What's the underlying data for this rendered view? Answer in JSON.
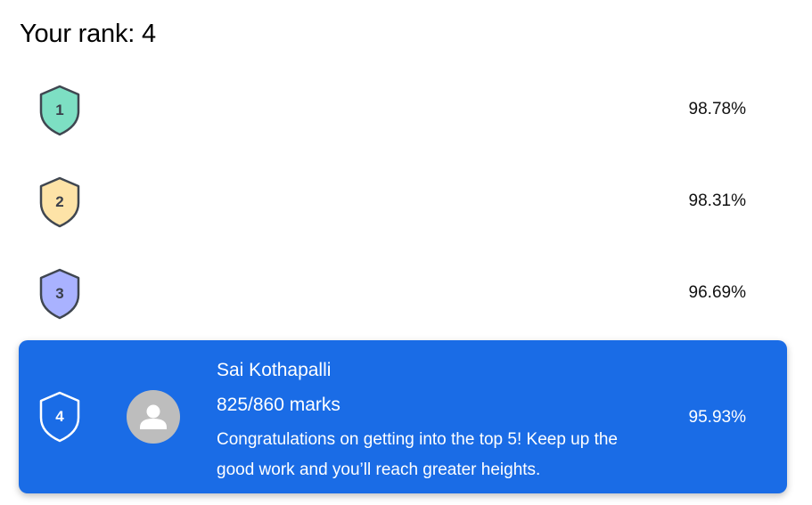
{
  "header": {
    "title": "Your rank: 4"
  },
  "leaderboard": {
    "rows": [
      {
        "rank": "1",
        "percent": "98.78%",
        "color": "#7ddfc3"
      },
      {
        "rank": "2",
        "percent": "98.31%",
        "color": "#fde3a7"
      },
      {
        "rank": "3",
        "percent": "96.69%",
        "color": "#a9b2ff"
      }
    ],
    "current_user": {
      "rank": "4",
      "name": "Sai Kothapalli",
      "marks": "825/860 marks",
      "message": "Congratulations on getting into the top 5! Keep up the good work and you’ll reach greater heights.",
      "percent": "95.93%",
      "highlight_color": "#1a6ce6",
      "avatar_icon": "person-icon"
    }
  }
}
